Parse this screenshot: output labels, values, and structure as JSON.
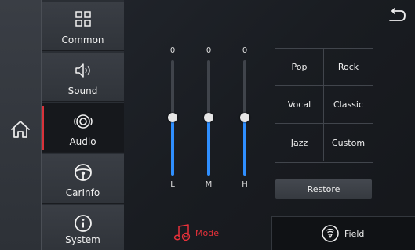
{
  "navigation": {
    "home_icon": "home-icon",
    "back_icon": "back-arrow-icon"
  },
  "menu": {
    "items": [
      {
        "label": "Common",
        "icon": "grid-icon",
        "active": false
      },
      {
        "label": "Sound",
        "icon": "speaker-icon",
        "active": false
      },
      {
        "label": "Audio",
        "icon": "audio-speaker-icon",
        "active": true
      },
      {
        "label": "CarInfo",
        "icon": "steering-wheel-icon",
        "active": false
      },
      {
        "label": "System",
        "icon": "info-icon",
        "active": false
      }
    ]
  },
  "equalizer": {
    "bands": [
      {
        "label": "L",
        "value": "0"
      },
      {
        "label": "M",
        "value": "0"
      },
      {
        "label": "H",
        "value": "0"
      }
    ]
  },
  "presets": {
    "items": [
      "Pop",
      "Rock",
      "Vocal",
      "Classic",
      "Jazz",
      "Custom"
    ],
    "restore_label": "Restore"
  },
  "tabs": {
    "mode_label": "Mode",
    "field_label": "Field",
    "active": "Mode"
  },
  "colors": {
    "accent": "#e8313a",
    "slider_fill": "#2f8fff"
  }
}
